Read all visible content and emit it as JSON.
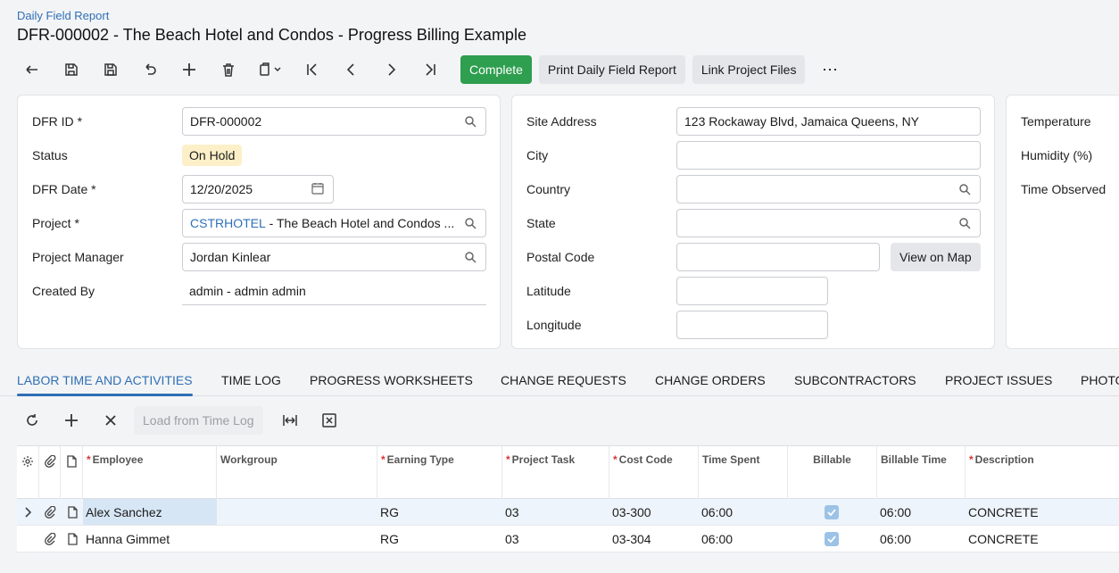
{
  "header": {
    "breadcrumb": "Daily Field Report",
    "title": "DFR-000002 - The Beach Hotel and Condos - Progress Billing Example"
  },
  "toolbar": {
    "icons": [
      "back-icon",
      "save-close-icon",
      "save-icon",
      "undo-icon",
      "add-icon",
      "delete-icon",
      "copy-paste-icon",
      "first-record-icon",
      "previous-icon",
      "next-icon",
      "last-record-icon"
    ],
    "complete_label": "Complete",
    "print_label": "Print Daily Field Report",
    "link_files_label": "Link Project Files",
    "more_label": "⋯"
  },
  "summary": {
    "dfr_id_label": "DFR ID",
    "dfr_id_value": "DFR-000002",
    "status_label": "Status",
    "status_value": "On Hold",
    "dfr_date_label": "DFR Date",
    "dfr_date_value": "12/20/2025",
    "project_label": "Project",
    "project_code": "CSTRHOTEL",
    "project_name": " - The Beach Hotel and Condos ...",
    "pm_label": "Project Manager",
    "pm_value": "Jordan Kinlear",
    "created_by_label": "Created By",
    "created_by_value": "admin - admin admin",
    "required_mark": "*"
  },
  "address": {
    "site_address_label": "Site Address",
    "site_address_value": "123 Rockaway Blvd, Jamaica Queens, NY",
    "city_label": "City",
    "country_label": "Country",
    "state_label": "State",
    "postal_label": "Postal Code",
    "view_map_label": "View on Map",
    "latitude_label": "Latitude",
    "longitude_label": "Longitude"
  },
  "weather": {
    "temperature_label": "Temperature",
    "humidity_label": "Humidity (%)",
    "time_observed_label": "Time Observed"
  },
  "tabs": [
    {
      "label": "LABOR TIME AND ACTIVITIES",
      "active": true
    },
    {
      "label": "TIME LOG"
    },
    {
      "label": "PROGRESS WORKSHEETS"
    },
    {
      "label": "CHANGE REQUESTS"
    },
    {
      "label": "CHANGE ORDERS"
    },
    {
      "label": "SUBCONTRACTORS"
    },
    {
      "label": "PROJECT ISSUES"
    },
    {
      "label": "PHOTO"
    }
  ],
  "grid_toolbar": {
    "load_label": "Load from Time Log"
  },
  "grid": {
    "columns": {
      "employee": "Employee",
      "workgroup": "Workgroup",
      "earning_type": "Earning Type",
      "project_task": "Project Task",
      "cost_code": "Cost Code",
      "time_spent": "Time Spent",
      "billable": "Billable",
      "billable_time": "Billable Time",
      "description": "Description"
    },
    "rows": [
      {
        "employee": "Alex Sanchez",
        "workgroup": "",
        "earning_type": "RG",
        "project_task": "03",
        "cost_code": "03-300",
        "time_spent": "06:00",
        "billable": true,
        "billable_time": "06:00",
        "description": "CONCRETE"
      },
      {
        "employee": "Hanna Gimmet",
        "workgroup": "",
        "earning_type": "RG",
        "project_task": "03",
        "cost_code": "03-304",
        "time_spent": "06:00",
        "billable": true,
        "billable_time": "06:00",
        "description": "CONCRETE"
      }
    ]
  },
  "colors": {
    "accent": "#2f6fb5",
    "primary_button": "#2e9e4f",
    "status_badge": "#fdf0c8"
  }
}
